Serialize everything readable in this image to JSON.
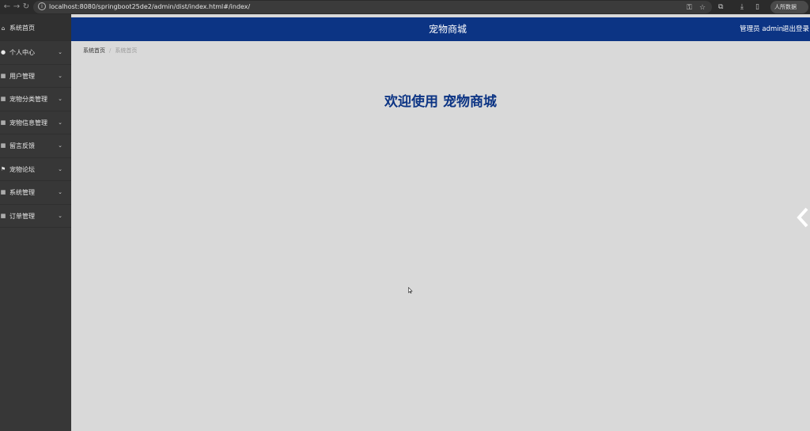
{
  "browser": {
    "back_icon": "arrow-left-icon",
    "forward_icon": "arrow-right-icon",
    "reload_icon": "reload-icon",
    "url": "localhost:8080/springboot25de2/admin/dist/index.html#/index/",
    "profile_label": "人所数据"
  },
  "sidebar": {
    "items": [
      {
        "label": "系统首页",
        "icon": "home-icon"
      },
      {
        "label": "个人中心",
        "icon": "user-icon"
      },
      {
        "label": "用户管理",
        "icon": "grid-icon"
      },
      {
        "label": "宠物分类管理",
        "icon": "grid-icon"
      },
      {
        "label": "宠物信息管理",
        "icon": "grid-icon"
      },
      {
        "label": "留言反馈",
        "icon": "grid-icon"
      },
      {
        "label": "宠物论坛",
        "icon": "flag-icon"
      },
      {
        "label": "系统管理",
        "icon": "grid-icon"
      },
      {
        "label": "订单管理",
        "icon": "grid-icon"
      }
    ]
  },
  "header": {
    "title": "宠物商城",
    "admin_label": "管理员 admin",
    "logout_label": "退出登录"
  },
  "breadcrumb": {
    "home": "系统首页",
    "separator": "/",
    "current": "系统首页"
  },
  "main": {
    "welcome": "欢迎使用 宠物商城"
  },
  "colors": {
    "header_bg": "#0c3484",
    "sidebar_bg": "#373737",
    "content_bg": "#d9d9d9",
    "welcome_text": "#0c3484"
  }
}
